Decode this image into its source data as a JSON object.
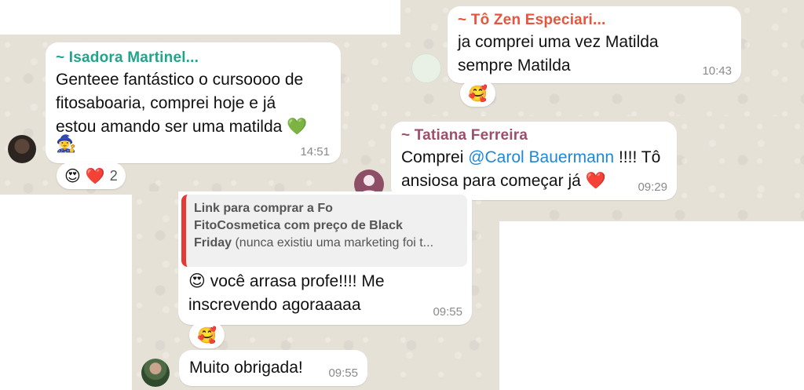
{
  "colors": {
    "chat_bg": "#e6e1d7",
    "sender_isadora": "#1fa58a",
    "sender_tozen": "#e8543e",
    "sender_tatiana": "#9b4f6b",
    "mention": "#1e88d6",
    "quote_bar": "#e53935",
    "timestamp": "#8a8a8a"
  },
  "messages": {
    "isadora": {
      "sender": "~ Isadora Martinel...",
      "line1": "Genteee fantástico o cursoooo de",
      "line2": "fitosaboaria, comprei hoje e já",
      "line3": "estou amando ser uma matilda",
      "emoji_end": "💚",
      "emoji_extra": "🧙‍♀️",
      "time": "14:51",
      "reactions": [
        "😍",
        "❤️"
      ],
      "reaction_count": "2"
    },
    "tozen": {
      "sender": "~ Tô Zen Especiari...",
      "line1": "ja comprei uma vez Matilda",
      "line2": "sempre Matilda",
      "time": "10:43",
      "reaction": "🥰"
    },
    "tatiana": {
      "sender": "~ Tatiana Ferreira",
      "pre": "Comprei ",
      "mention": "@Carol Bauermann",
      "post": " !!!! Tô",
      "line2": "ansiosa para começar já",
      "emoji_end": "❤️",
      "time": "09:29",
      "reaction": "❤️"
    },
    "reply": {
      "quote_line1": "Link para comprar a Fo",
      "quote_line2": "FitoCosmetica com preço de Black",
      "quote_line3_bold": "Friday",
      "quote_line3_rest": " (nunca existiu uma marketing foi t...",
      "emoji_start": "😍",
      "line1": " você arrasa profe!!!! Me",
      "line2": "inscrevendo agoraaaaa",
      "time": "09:55",
      "reaction": "🥰"
    },
    "thanks": {
      "text": "Muito obrigada!",
      "time": "09:55"
    }
  }
}
